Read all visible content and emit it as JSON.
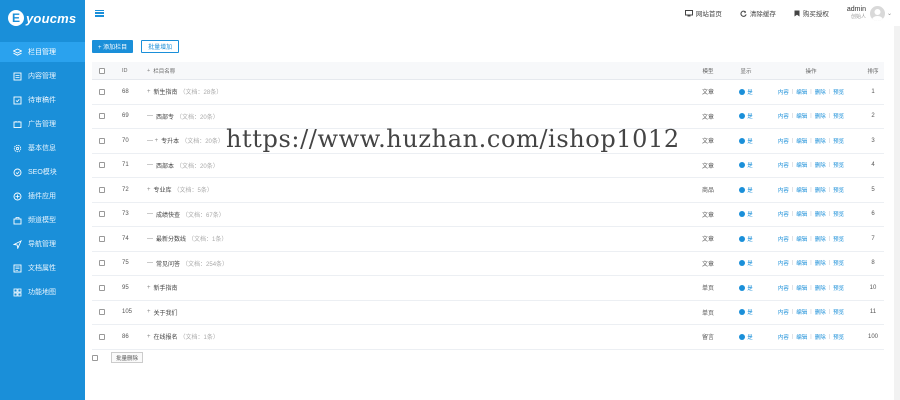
{
  "brand": {
    "mark": "E",
    "name": "youcms"
  },
  "sidebar": {
    "items": [
      {
        "label": "栏目管理",
        "icon": "layers-icon",
        "active": true
      },
      {
        "label": "内容管理",
        "icon": "document-icon",
        "active": false
      },
      {
        "label": "待审稿件",
        "icon": "pending-icon",
        "active": false
      },
      {
        "label": "广告管理",
        "icon": "ad-icon",
        "active": false
      },
      {
        "label": "基本信息",
        "icon": "gear-icon",
        "active": false
      },
      {
        "label": "SEO模块",
        "icon": "seo-icon",
        "active": false
      },
      {
        "label": "插件应用",
        "icon": "plugin-icon",
        "active": false
      },
      {
        "label": "频道模型",
        "icon": "model-icon",
        "active": false
      },
      {
        "label": "导航管理",
        "icon": "navigation-icon",
        "active": false
      },
      {
        "label": "文档属性",
        "icon": "attribute-icon",
        "active": false
      },
      {
        "label": "功能地图",
        "icon": "grid-icon",
        "active": false
      }
    ]
  },
  "topbar": {
    "home_link": "网站首页",
    "clear_cache": "清除缓存",
    "buy_license": "购买授权",
    "user_name": "admin",
    "user_role": "创始人"
  },
  "toolbar": {
    "add_label": "+ 添加栏目",
    "batch_add_label": "批量增加"
  },
  "table": {
    "headers": {
      "id": "ID",
      "name": "栏目名称",
      "model": "模型",
      "show": "显示",
      "ops": "操作",
      "sort": "排序"
    },
    "op_labels": {
      "content": "内容",
      "edit": "编辑",
      "delete": "删除",
      "preview": "预览"
    },
    "rows": [
      {
        "id": "68",
        "prefix": "+",
        "name": "新生指南",
        "info": "（文档：28条）",
        "model": "文章",
        "show": "是",
        "sort": "1"
      },
      {
        "id": "69",
        "prefix": "—",
        "name": "西部专",
        "info": "（文档：20条）",
        "model": "文章",
        "show": "是",
        "sort": "2"
      },
      {
        "id": "70",
        "prefix": "— +",
        "name": "专升本",
        "info": "（文档：20条）",
        "model": "文章",
        "show": "是",
        "sort": "3"
      },
      {
        "id": "71",
        "prefix": "—",
        "name": "西部本",
        "info": "（文档：20条）",
        "model": "文章",
        "show": "是",
        "sort": "4"
      },
      {
        "id": "72",
        "prefix": "+",
        "name": "专业库",
        "info": "（文档：5条）",
        "model": "商品",
        "show": "是",
        "sort": "5"
      },
      {
        "id": "73",
        "prefix": "—",
        "name": "成绩快查",
        "info": "（文档：67条）",
        "model": "文章",
        "show": "是",
        "sort": "6"
      },
      {
        "id": "74",
        "prefix": "—",
        "name": "最新分数线",
        "info": "（文档：1条）",
        "model": "文章",
        "show": "是",
        "sort": "7"
      },
      {
        "id": "75",
        "prefix": "—",
        "name": "常见问答",
        "info": "（文档：254条）",
        "model": "文章",
        "show": "是",
        "sort": "8"
      },
      {
        "id": "95",
        "prefix": "+",
        "name": "新手指南",
        "info": "",
        "model": "单页",
        "show": "是",
        "sort": "10"
      },
      {
        "id": "105",
        "prefix": "+",
        "name": "关于我们",
        "info": "",
        "model": "单页",
        "show": "是",
        "sort": "11"
      },
      {
        "id": "86",
        "prefix": "+",
        "name": "在线报名",
        "info": "（文档：1条）",
        "model": "留言",
        "show": "是",
        "sort": "100"
      }
    ]
  },
  "batch_delete_label": "批量删除",
  "watermark": "https://www.huzhan.com/ishop1012",
  "colors": {
    "primary": "#1a8fd9",
    "sidebar_active": "#2aa2ee"
  }
}
